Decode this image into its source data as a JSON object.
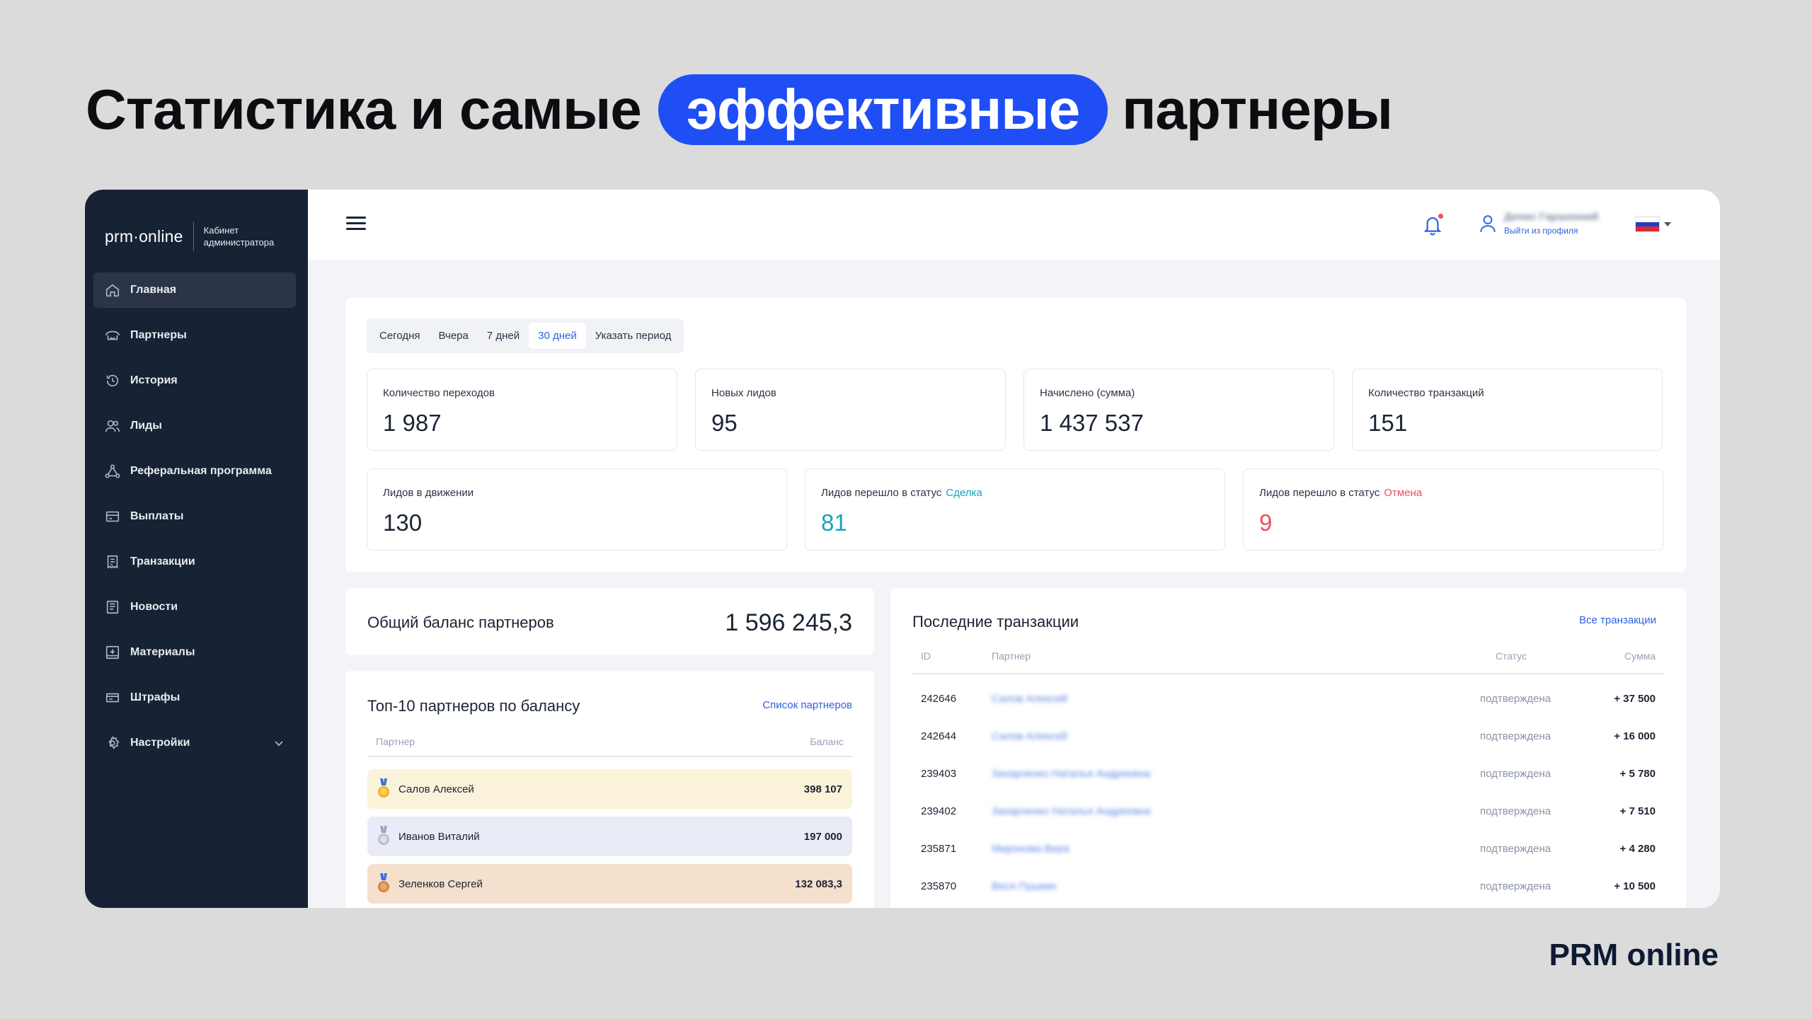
{
  "headline": {
    "before": "Статистика и самые",
    "highlight": "эффективные",
    "after": "партнеры"
  },
  "brand_footer": "PRM online",
  "colors": {
    "accent": "#1f4ef5",
    "link": "#2f62e0",
    "sidebar_bg": "#182235",
    "teal": "#18a3b8",
    "red": "#ef4d5b"
  },
  "sidebar": {
    "logo": "prm·online",
    "logo_subtitle_1": "Кабинет",
    "logo_subtitle_2": "администратора",
    "items": [
      {
        "label": "Главная",
        "icon": "home-icon"
      },
      {
        "label": "Партнеры",
        "icon": "handshake-icon"
      },
      {
        "label": "История",
        "icon": "history-icon"
      },
      {
        "label": "Лиды",
        "icon": "users-icon"
      },
      {
        "label": "Реферальная программа",
        "icon": "network-icon"
      },
      {
        "label": "Выплаты",
        "icon": "wallet-icon"
      },
      {
        "label": "Транзакции",
        "icon": "receipt-icon"
      },
      {
        "label": "Новости",
        "icon": "newspaper-icon"
      },
      {
        "label": "Материалы",
        "icon": "materials-icon"
      },
      {
        "label": "Штрафы",
        "icon": "card-icon"
      },
      {
        "label": "Настройки",
        "icon": "gear-icon"
      }
    ]
  },
  "topbar": {
    "user_name": "Денис Гаршенний",
    "logout": "Выйти из профиля",
    "language_flag": "ru-flag-icon"
  },
  "periods": [
    "Сегодня",
    "Вчера",
    "7 дней",
    "30 дней",
    "Указать период"
  ],
  "selected_period": "30 дней",
  "stats": {
    "clicks": {
      "label": "Количество переходов",
      "value": "1 987"
    },
    "new_leads": {
      "label": "Новых лидов",
      "value": "95"
    },
    "accrued": {
      "label": "Начислено (сумма)",
      "value": "1 437 537"
    },
    "transactions": {
      "label": "Количество транзакций",
      "value": "151"
    },
    "moving": {
      "label": "Лидов в движении",
      "value": "130"
    },
    "to_deal": {
      "label": "Лидов перешло в статус",
      "tag": "Сделка",
      "value": "81"
    },
    "to_cancel": {
      "label": "Лидов перешло в статус",
      "tag": "Отмена",
      "value": "9"
    }
  },
  "balance": {
    "title": "Общий баланс партнеров",
    "value": "1 596 245,3"
  },
  "top_partners": {
    "title": "Топ-10 партнеров по балансу",
    "link": "Список партнеров",
    "col_partner": "Партнер",
    "col_balance": "Баланс",
    "rows": [
      {
        "name": "Салов Алексей",
        "amount": "398 107",
        "medal": "gold-medal-icon",
        "bg": "#fbf3d9"
      },
      {
        "name": "Иванов Виталий",
        "amount": "197 000",
        "medal": "silver-medal-icon",
        "bg": "#e9ecf6"
      },
      {
        "name": "Зеленков Сергей",
        "amount": "132 083,3",
        "medal": "bronze-medal-icon",
        "bg": "#f5dfcd"
      }
    ]
  },
  "transactions": {
    "title": "Последние транзакции",
    "link": "Все транзакции",
    "col_id": "ID",
    "col_partner": "Партнер",
    "col_status": "Статус",
    "col_sum": "Сумма",
    "rows": [
      {
        "id": "242646",
        "partner": "Салов Алексей",
        "status": "подтверждена",
        "sum": "+ 37 500"
      },
      {
        "id": "242644",
        "partner": "Салов Алексей",
        "status": "подтверждена",
        "sum": "+ 16 000"
      },
      {
        "id": "239403",
        "partner": "Захарченко Наталья Андреевна",
        "status": "подтверждена",
        "sum": "+ 5 780"
      },
      {
        "id": "239402",
        "partner": "Захарченко Наталья Андреевна",
        "status": "подтверждена",
        "sum": "+ 7 510"
      },
      {
        "id": "235871",
        "partner": "Миронова Вера",
        "status": "подтверждена",
        "sum": "+ 4 280"
      },
      {
        "id": "235870",
        "partner": "Веся Пушкин",
        "status": "подтверждена",
        "sum": "+ 10 500"
      }
    ]
  }
}
